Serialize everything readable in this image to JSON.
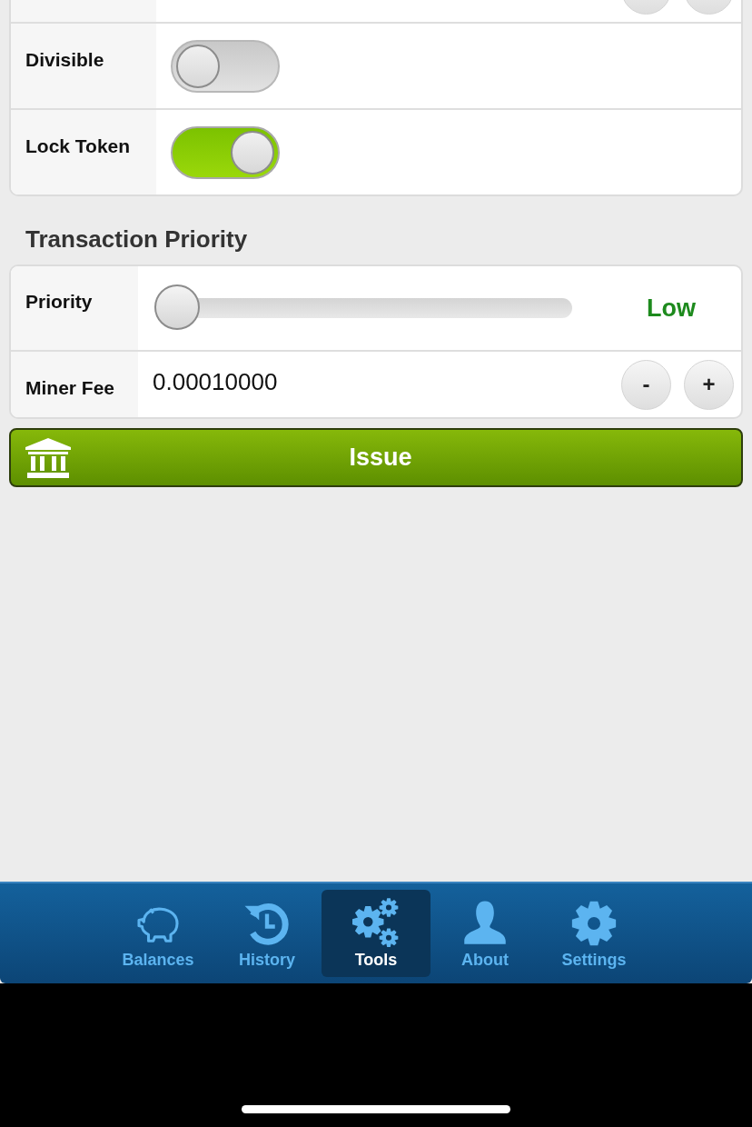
{
  "form_rows": [
    {
      "kind": "stepper"
    },
    {
      "kind": "toggle",
      "label": "Divisible",
      "on": false
    },
    {
      "kind": "toggle",
      "label": "Lock Token",
      "on": true
    }
  ],
  "priority_section": {
    "title": "Transaction Priority",
    "rows": [
      {
        "kind": "slider",
        "label": "Priority",
        "level": 0,
        "reading": "Low"
      },
      {
        "kind": "stepper",
        "label": "Miner Fee",
        "value": "0.00010000",
        "decrement": "-",
        "increment": "+"
      }
    ]
  },
  "issue_button": {
    "label": "Issue"
  },
  "tab_bar": {
    "tabs": [
      {
        "label": "Balances",
        "selected": false
      },
      {
        "label": "History",
        "selected": false
      },
      {
        "label": "Tools",
        "selected": true
      },
      {
        "label": "About",
        "selected": false
      },
      {
        "label": "Settings",
        "selected": false
      }
    ]
  }
}
